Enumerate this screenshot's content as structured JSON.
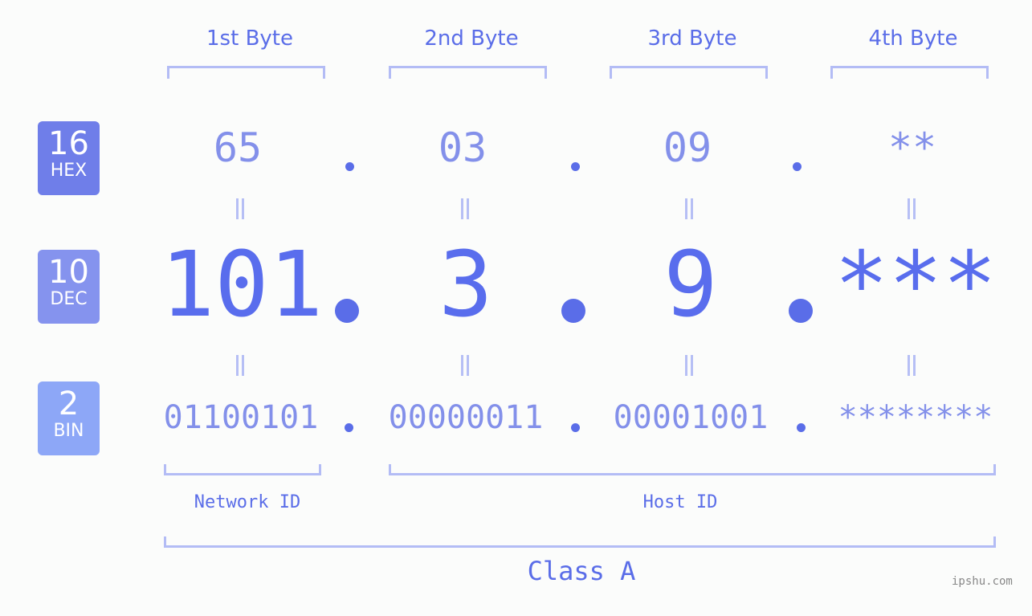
{
  "headers": [
    "1st Byte",
    "2nd Byte",
    "3rd Byte",
    "4th Byte"
  ],
  "badges": {
    "hex": {
      "num": "16",
      "label": "HEX",
      "color": "#6f7ee9"
    },
    "dec": {
      "num": "10",
      "label": "DEC",
      "color": "#8593ee"
    },
    "bin": {
      "num": "2",
      "label": "BIN",
      "color": "#8da7f7"
    }
  },
  "hex": [
    "65",
    "03",
    "09",
    "**"
  ],
  "dec": [
    "101",
    "3",
    "9",
    "***"
  ],
  "bin": [
    "01100101",
    "00000011",
    "00001001",
    "********"
  ],
  "network_label": "Network ID",
  "host_label": "Host ID",
  "class_label": "Class A",
  "watermark": "ipshu.com"
}
